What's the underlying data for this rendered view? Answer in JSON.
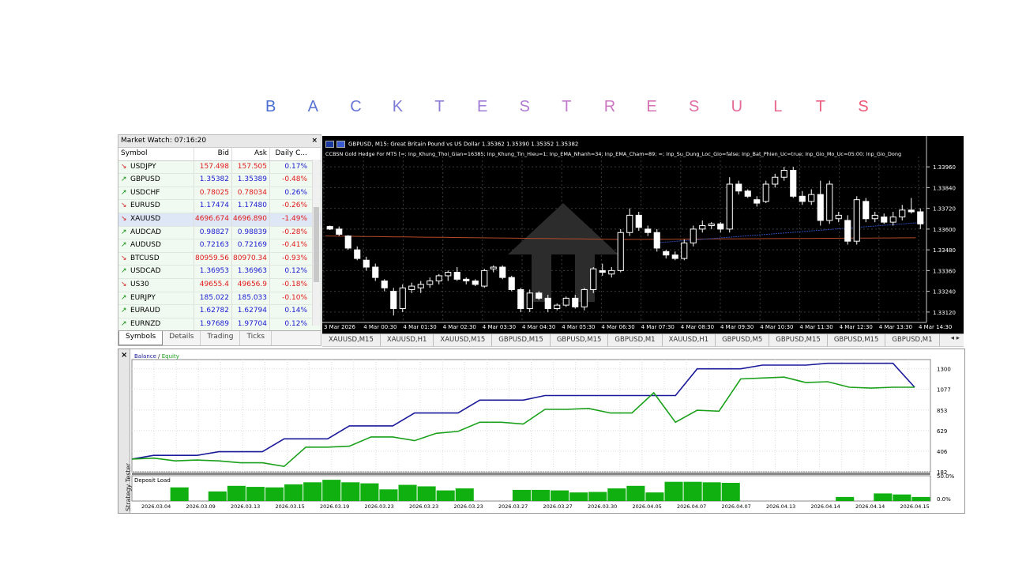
{
  "headline": {
    "letters": [
      "B",
      "A",
      "C",
      "K",
      "T",
      "E",
      "S",
      "T",
      "R",
      "E",
      "S",
      "U",
      "L",
      "T",
      "S"
    ],
    "colors": [
      "#4a6fd0",
      "#5a73d4",
      "#6a78d6",
      "#7c7ad8",
      "#8e7bd8",
      "#a07bd6",
      "#b07ad2",
      "#c079cc",
      "#cc76c2",
      "#d672b4",
      "#de6ea6",
      "#e46a98",
      "#e8668c",
      "#eb5f80",
      "#ee5874"
    ]
  },
  "market_watch": {
    "title": "Market Watch: 07:16:20",
    "close": "×",
    "headers": {
      "symbol": "Symbol",
      "bid": "Bid",
      "ask": "Ask",
      "change": "Daily C..."
    },
    "rows": [
      {
        "symbol": "USDJPY",
        "dir": "down",
        "bid": "157.498",
        "ask": "157.505",
        "change": "0.17%",
        "bid_color": "red",
        "ask_color": "red",
        "chg_color": "blue"
      },
      {
        "symbol": "GBPUSD",
        "dir": "up",
        "bid": "1.35382",
        "ask": "1.35389",
        "change": "-0.48%",
        "bid_color": "blue",
        "ask_color": "blue",
        "chg_color": "red"
      },
      {
        "symbol": "USDCHF",
        "dir": "up",
        "bid": "0.78025",
        "ask": "0.78034",
        "change": "0.26%",
        "bid_color": "red",
        "ask_color": "red",
        "chg_color": "blue"
      },
      {
        "symbol": "EURUSD",
        "dir": "down",
        "bid": "1.17474",
        "ask": "1.17480",
        "change": "-0.26%",
        "bid_color": "blue",
        "ask_color": "blue",
        "chg_color": "red"
      },
      {
        "symbol": "XAUUSD",
        "dir": "down",
        "bid": "4696.674",
        "ask": "4696.890",
        "change": "-1.49%",
        "bid_color": "red",
        "ask_color": "red",
        "chg_color": "red"
      },
      {
        "symbol": "AUDCAD",
        "dir": "up",
        "bid": "0.98827",
        "ask": "0.98839",
        "change": "-0.28%",
        "bid_color": "blue",
        "ask_color": "blue",
        "chg_color": "red"
      },
      {
        "symbol": "AUDUSD",
        "dir": "up",
        "bid": "0.72163",
        "ask": "0.72169",
        "change": "-0.41%",
        "bid_color": "blue",
        "ask_color": "blue",
        "chg_color": "red"
      },
      {
        "symbol": "BTCUSD",
        "dir": "down",
        "bid": "80959.56",
        "ask": "80970.34",
        "change": "-0.93%",
        "bid_color": "red",
        "ask_color": "red",
        "chg_color": "red"
      },
      {
        "symbol": "USDCAD",
        "dir": "up",
        "bid": "1.36953",
        "ask": "1.36963",
        "change": "0.12%",
        "bid_color": "blue",
        "ask_color": "blue",
        "chg_color": "blue"
      },
      {
        "symbol": "US30",
        "dir": "down",
        "bid": "49655.4",
        "ask": "49656.9",
        "change": "-0.18%",
        "bid_color": "red",
        "ask_color": "red",
        "chg_color": "red"
      },
      {
        "symbol": "EURJPY",
        "dir": "up",
        "bid": "185.022",
        "ask": "185.033",
        "change": "-0.10%",
        "bid_color": "blue",
        "ask_color": "blue",
        "chg_color": "red"
      },
      {
        "symbol": "EURAUD",
        "dir": "up",
        "bid": "1.62782",
        "ask": "1.62794",
        "change": "0.14%",
        "bid_color": "blue",
        "ask_color": "blue",
        "chg_color": "blue"
      },
      {
        "symbol": "EURNZD",
        "dir": "up",
        "bid": "1.97689",
        "ask": "1.97704",
        "change": "0.12%",
        "bid_color": "blue",
        "ask_color": "blue",
        "chg_color": "blue"
      }
    ],
    "tabs": [
      "Symbols",
      "Details",
      "Trading",
      "Ticks"
    ],
    "selected_row": "XAUUSD"
  },
  "price_chart": {
    "info_line": "GBPUSD, M15:  Great Britain Pound vs US Dollar  1.35362 1.35390 1.35352 1.35382",
    "ea_line": "CCBSN Gold Hedge For MT5 [=; Inp_Khung_Thoi_Gian=16385; Inp_Khung_Tin_Hieu=1; Inp_EMA_Nhanh=34; Inp_EMA_Cham=89; =; Inp_Su_Dung_Loc_Gio=false; Inp_Bat_Phien_Uc=true; Inp_Gio_Mo_Uc=05:00; Inp_Gio_Dong",
    "y_ticks": [
      "1.33960",
      "1.33840",
      "1.33720",
      "1.33600",
      "1.33480",
      "1.33360",
      "1.33240",
      "1.33120"
    ],
    "x_ticks": [
      "3 Mar 2026",
      "4 Mar 00:30",
      "4 Mar 01:30",
      "4 Mar 02:30",
      "4 Mar 03:30",
      "4 Mar 04:30",
      "4 Mar 05:30",
      "4 Mar 06:30",
      "4 Mar 07:30",
      "4 Mar 08:30",
      "4 Mar 09:30",
      "4 Mar 10:30",
      "4 Mar 11:30",
      "4 Mar 12:30",
      "4 Mar 13:30",
      "4 Mar 14:30"
    ],
    "candles": [
      [
        1.33615,
        1.3362,
        1.33595,
        1.336
      ],
      [
        1.336,
        1.33615,
        1.3356,
        1.3357
      ],
      [
        1.3356,
        1.33565,
        1.3348,
        1.3349
      ],
      [
        1.3348,
        1.335,
        1.3342,
        1.3343
      ],
      [
        1.3342,
        1.3344,
        1.3336,
        1.3338
      ],
      [
        1.3338,
        1.334,
        1.333,
        1.3332
      ],
      [
        1.333,
        1.3331,
        1.3324,
        1.3326
      ],
      [
        1.3324,
        1.3326,
        1.331,
        1.3314
      ],
      [
        1.3314,
        1.3328,
        1.3312,
        1.3326
      ],
      [
        1.3325,
        1.3329,
        1.3323,
        1.3327
      ],
      [
        1.3326,
        1.333,
        1.3323,
        1.3328
      ],
      [
        1.3328,
        1.3332,
        1.3326,
        1.333
      ],
      [
        1.333,
        1.3334,
        1.3328,
        1.3333
      ],
      [
        1.3333,
        1.3336,
        1.333,
        1.3335
      ],
      [
        1.3335,
        1.3338,
        1.333,
        1.3331
      ],
      [
        1.3331,
        1.3332,
        1.3328,
        1.333
      ],
      [
        1.333,
        1.3331,
        1.3327,
        1.3328
      ],
      [
        1.3327,
        1.3337,
        1.3326,
        1.3336
      ],
      [
        1.3337,
        1.3339,
        1.3335,
        1.3338
      ],
      [
        1.3338,
        1.3339,
        1.3331,
        1.3332
      ],
      [
        1.3332,
        1.3333,
        1.3324,
        1.3325
      ],
      [
        1.3325,
        1.3326,
        1.3312,
        1.3314
      ],
      [
        1.3314,
        1.3325,
        1.3312,
        1.3323
      ],
      [
        1.3323,
        1.3324,
        1.3319,
        1.332
      ],
      [
        1.332,
        1.3322,
        1.3312,
        1.3314
      ],
      [
        1.3314,
        1.3317,
        1.3313,
        1.3316
      ],
      [
        1.3316,
        1.3321,
        1.3315,
        1.332
      ],
      [
        1.332,
        1.3322,
        1.3314,
        1.3315
      ],
      [
        1.3315,
        1.3326,
        1.3313,
        1.3325
      ],
      [
        1.3325,
        1.3338,
        1.3323,
        1.3337
      ],
      [
        1.3336,
        1.334,
        1.3333,
        1.3335
      ],
      [
        1.3334,
        1.3338,
        1.3332,
        1.3336
      ],
      [
        1.3336,
        1.336,
        1.3335,
        1.3358
      ],
      [
        1.3358,
        1.3372,
        1.3356,
        1.3368
      ],
      [
        1.3368,
        1.337,
        1.3359,
        1.3361
      ],
      [
        1.336,
        1.3362,
        1.3356,
        1.3358
      ],
      [
        1.3358,
        1.336,
        1.3347,
        1.3349
      ],
      [
        1.3347,
        1.3348,
        1.3343,
        1.3345
      ],
      [
        1.3345,
        1.3347,
        1.3342,
        1.3343
      ],
      [
        1.3343,
        1.3354,
        1.3342,
        1.3352
      ],
      [
        1.3352,
        1.3362,
        1.335,
        1.336
      ],
      [
        1.336,
        1.3365,
        1.3358,
        1.3362
      ],
      [
        1.3362,
        1.3364,
        1.336,
        1.3363
      ],
      [
        1.3363,
        1.3364,
        1.3358,
        1.336
      ],
      [
        1.336,
        1.339,
        1.3358,
        1.3386
      ],
      [
        1.3386,
        1.3388,
        1.338,
        1.3382
      ],
      [
        1.3382,
        1.3383,
        1.3378,
        1.3379
      ],
      [
        1.3377,
        1.3379,
        1.3373,
        1.3375
      ],
      [
        1.3376,
        1.3388,
        1.3375,
        1.3386
      ],
      [
        1.3386,
        1.3392,
        1.3384,
        1.339
      ],
      [
        1.339,
        1.3396,
        1.3388,
        1.3394
      ],
      [
        1.3394,
        1.3396,
        1.3378,
        1.3379
      ],
      [
        1.3379,
        1.3382,
        1.3374,
        1.3376
      ],
      [
        1.3376,
        1.3383,
        1.3374,
        1.338
      ],
      [
        1.338,
        1.3388,
        1.3362,
        1.3365
      ],
      [
        1.3365,
        1.3388,
        1.3363,
        1.3386
      ],
      [
        1.3366,
        1.337,
        1.3364,
        1.3368
      ],
      [
        1.3365,
        1.3368,
        1.3351,
        1.3353
      ],
      [
        1.3353,
        1.3379,
        1.3351,
        1.3377
      ],
      [
        1.3376,
        1.3378,
        1.3364,
        1.3366
      ],
      [
        1.3366,
        1.337,
        1.3364,
        1.3368
      ],
      [
        1.3367,
        1.3369,
        1.3363,
        1.3364
      ],
      [
        1.3364,
        1.337,
        1.3362,
        1.3367
      ],
      [
        1.3367,
        1.3374,
        1.3365,
        1.3371
      ],
      [
        1.3371,
        1.3378,
        1.3369,
        1.337
      ],
      [
        1.337,
        1.3372,
        1.336,
        1.3363
      ]
    ],
    "tabs": [
      "XAUUSD,M15",
      "XAUUSD,H1",
      "XAUUSD,M15",
      "GBPUSD,M15",
      "GBPUSD,M15",
      "GBPUSD,M1",
      "XAUUSD,H1",
      "GBPUSD,M5",
      "GBPUSD,M15",
      "GBPUSD,M15",
      "GBPUSD,M1"
    ],
    "tab_nav": "◂ ▸"
  },
  "tester": {
    "close": "×",
    "side_label": "Strategy Tester",
    "legend_balance": "Balance",
    "legend_sep": " / ",
    "legend_equity": "Equity",
    "balance_color": "#1a1a9a",
    "equity_color": "#1aa01a",
    "deposit_label": "Deposit Load",
    "y_ticks": [
      "1300",
      "1077",
      "853",
      "629",
      "406",
      "182"
    ],
    "load_ticks": [
      "50.0%",
      "0.0%"
    ],
    "x_dates": [
      "2026.03.04",
      "2026.03.09",
      "2026.03.13",
      "2026.03.15",
      "2026.03.19",
      "2026.03.23",
      "2026.03.23",
      "2026.03.23",
      "2026.03.27",
      "2026.03.27",
      "2026.03.30",
      "2026.04.05",
      "2026.04.07",
      "2026.04.07",
      "2026.04.13",
      "2026.04.14",
      "2026.04.14",
      "2026.04.15"
    ]
  },
  "chart_data": [
    {
      "type": "line",
      "title": "Balance / Equity",
      "ylim": [
        182,
        1400
      ],
      "series": [
        {
          "name": "Balance",
          "values": [
            320,
            360,
            360,
            360,
            400,
            400,
            400,
            540,
            540,
            540,
            680,
            680,
            680,
            820,
            820,
            820,
            960,
            960,
            960,
            1010,
            1010,
            1010,
            1010,
            1010,
            1010,
            1010,
            1300,
            1300,
            1300,
            1340,
            1340,
            1340,
            1360,
            1360,
            1360,
            1360,
            1100
          ]
        },
        {
          "name": "Equity",
          "values": [
            320,
            330,
            300,
            310,
            300,
            280,
            280,
            240,
            450,
            450,
            460,
            560,
            560,
            520,
            600,
            620,
            720,
            720,
            700,
            860,
            860,
            870,
            820,
            820,
            1040,
            720,
            850,
            840,
            1190,
            1200,
            1210,
            1150,
            1160,
            1100,
            1090,
            1100,
            1100
          ]
        }
      ]
    },
    {
      "type": "bar",
      "title": "Deposit Load",
      "ylim": [
        0,
        50
      ],
      "values": [
        0,
        0,
        27,
        0,
        19,
        30,
        28,
        27,
        33,
        37,
        42,
        37,
        35,
        23,
        32,
        29,
        21,
        25,
        0,
        0,
        22,
        22,
        21,
        17,
        18,
        25,
        30,
        17,
        38,
        38,
        37,
        36,
        0,
        0,
        0,
        0,
        0,
        8,
        0,
        15,
        13,
        8
      ]
    }
  ]
}
